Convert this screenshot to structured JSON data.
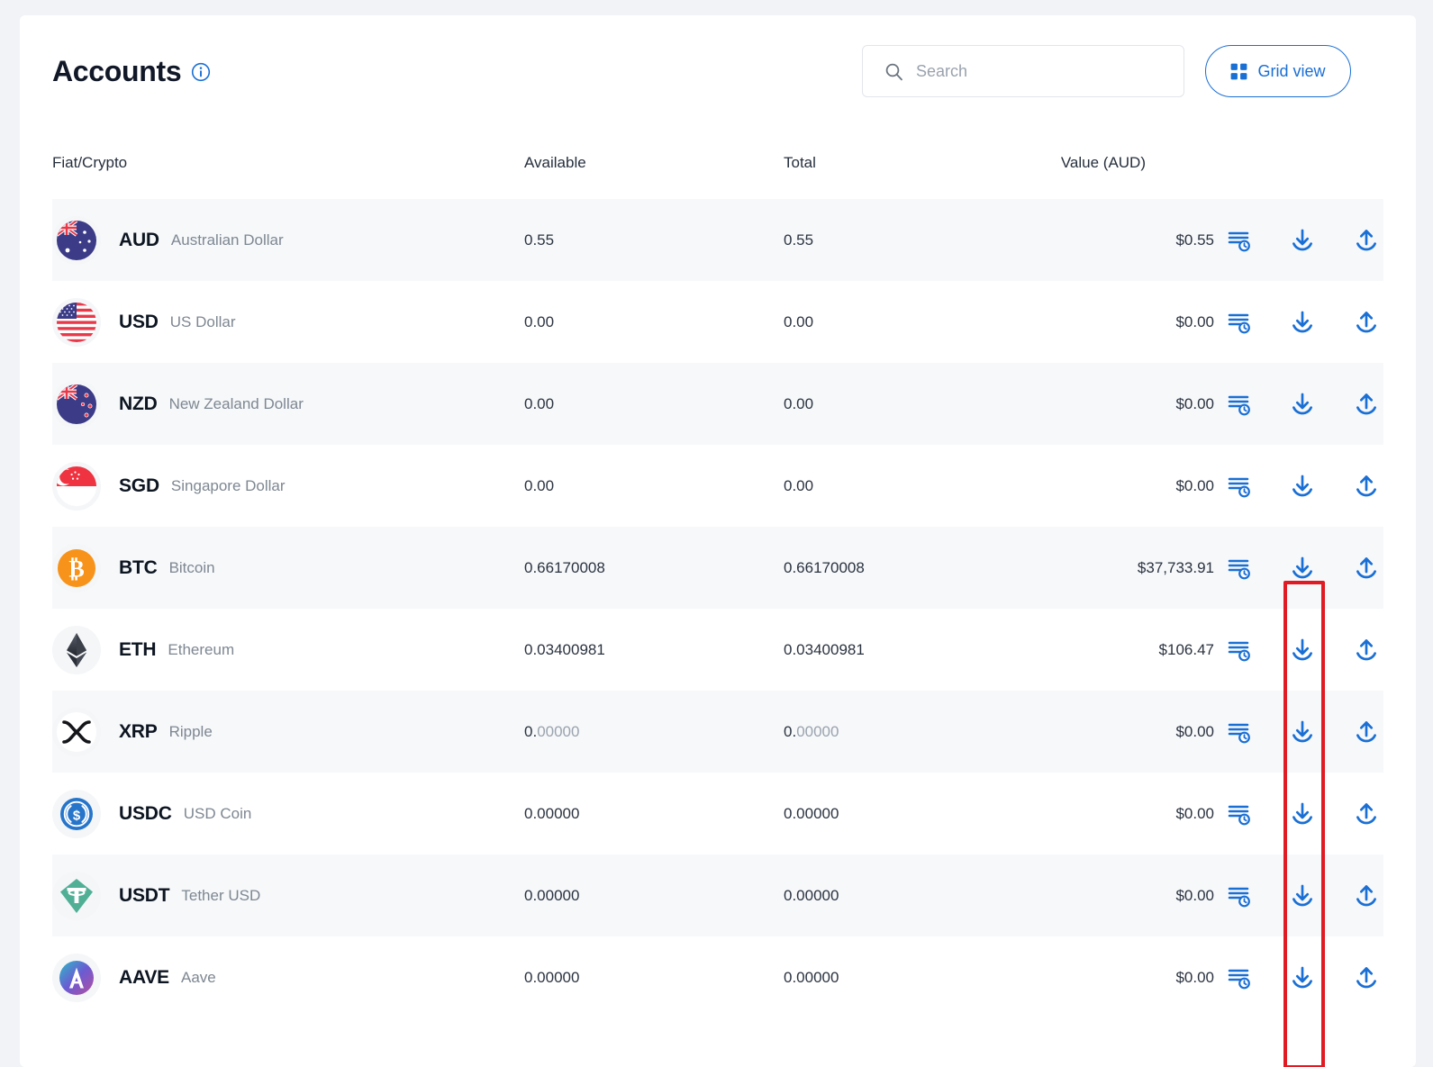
{
  "header": {
    "title": "Accounts",
    "info_icon": "info-circle-icon",
    "search": {
      "placeholder": "Search",
      "value": "",
      "icon": "search-icon"
    },
    "grid_view": {
      "label": "Grid view",
      "icon": "grid-icon"
    }
  },
  "table": {
    "columns": {
      "asset": "Fiat/Crypto",
      "available": "Available",
      "total": "Total",
      "value": "Value (AUD)"
    },
    "actions": {
      "history": "transaction-history-icon",
      "deposit": "deposit-download-icon",
      "withdraw": "withdraw-upload-icon"
    },
    "rows": [
      {
        "code": "AUD",
        "name": "Australian Dollar",
        "icon": "flag-australia-icon",
        "available": "0.55",
        "available_dim": "",
        "total": "0.55",
        "total_dim": "",
        "value": "$0.55"
      },
      {
        "code": "USD",
        "name": "US Dollar",
        "icon": "flag-usa-icon",
        "available": "0.00",
        "available_dim": "",
        "total": "0.00",
        "total_dim": "",
        "value": "$0.00"
      },
      {
        "code": "NZD",
        "name": "New Zealand Dollar",
        "icon": "flag-new-zealand-icon",
        "available": "0.00",
        "available_dim": "",
        "total": "0.00",
        "total_dim": "",
        "value": "$0.00"
      },
      {
        "code": "SGD",
        "name": "Singapore Dollar",
        "icon": "flag-singapore-icon",
        "available": "0.00",
        "available_dim": "",
        "total": "0.00",
        "total_dim": "",
        "value": "$0.00"
      },
      {
        "code": "BTC",
        "name": "Bitcoin",
        "icon": "bitcoin-icon",
        "available": "0.66170008",
        "available_dim": "",
        "total": "0.66170008",
        "total_dim": "",
        "value": "$37,733.91"
      },
      {
        "code": "ETH",
        "name": "Ethereum",
        "icon": "ethereum-icon",
        "available": "0.03400981",
        "available_dim": "",
        "total": "0.03400981",
        "total_dim": "",
        "value": "$106.47"
      },
      {
        "code": "XRP",
        "name": "Ripple",
        "icon": "ripple-icon",
        "available": "0.",
        "available_dim": "00000",
        "total": "0.",
        "total_dim": "00000",
        "value": "$0.00"
      },
      {
        "code": "USDC",
        "name": "USD Coin",
        "icon": "usd-coin-icon",
        "available": "0.00000",
        "available_dim": "",
        "total": "0.00000",
        "total_dim": "",
        "value": "$0.00"
      },
      {
        "code": "USDT",
        "name": "Tether USD",
        "icon": "tether-icon",
        "available": "0.00000",
        "available_dim": "",
        "total": "0.00000",
        "total_dim": "",
        "value": "$0.00"
      },
      {
        "code": "AAVE",
        "name": "Aave",
        "icon": "aave-icon",
        "available": "0.00000",
        "available_dim": "",
        "total": "0.00000",
        "total_dim": "",
        "value": "$0.00"
      }
    ]
  },
  "annotation": {
    "type": "highlight-rectangle",
    "color": "#e01b24",
    "target": "deposit-download-icon-column"
  },
  "colors": {
    "accent_blue": "#1a6fd4",
    "row_alt": "#f6f8fa",
    "page_bg": "#f1f3f6",
    "annotation_red": "#e01b24"
  }
}
